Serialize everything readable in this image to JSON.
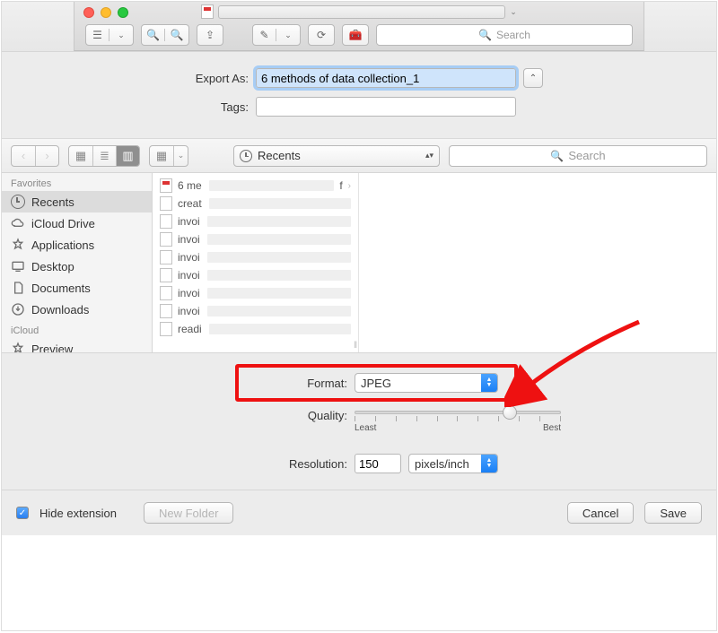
{
  "titlebar": {
    "search_placeholder": "Search"
  },
  "export": {
    "label": "Export As:",
    "filename": "6 methods of data collection_1",
    "tags_label": "Tags:",
    "tags_value": ""
  },
  "browser": {
    "location": "Recents",
    "search_placeholder": "Search",
    "sidebar": {
      "group1": "Favorites",
      "group2": "iCloud",
      "items": [
        {
          "label": "Recents"
        },
        {
          "label": "iCloud Drive"
        },
        {
          "label": "Applications"
        },
        {
          "label": "Desktop"
        },
        {
          "label": "Documents"
        },
        {
          "label": "Downloads"
        }
      ],
      "icloud_item": "Preview"
    },
    "files": [
      {
        "label": "6 me",
        "tail": "f"
      },
      {
        "label": "creat"
      },
      {
        "label": "invoi"
      },
      {
        "label": "invoi"
      },
      {
        "label": "invoi"
      },
      {
        "label": "invoi"
      },
      {
        "label": "invoi"
      },
      {
        "label": "invoi"
      },
      {
        "label": "readi"
      }
    ]
  },
  "options": {
    "format_label": "Format:",
    "format_value": "JPEG",
    "quality_label": "Quality:",
    "quality_least": "Least",
    "quality_best": "Best",
    "resolution_label": "Resolution:",
    "resolution_value": "150",
    "resolution_unit": "pixels/inch"
  },
  "footer": {
    "hide_ext": "Hide extension",
    "new_folder": "New Folder",
    "cancel": "Cancel",
    "save": "Save"
  }
}
